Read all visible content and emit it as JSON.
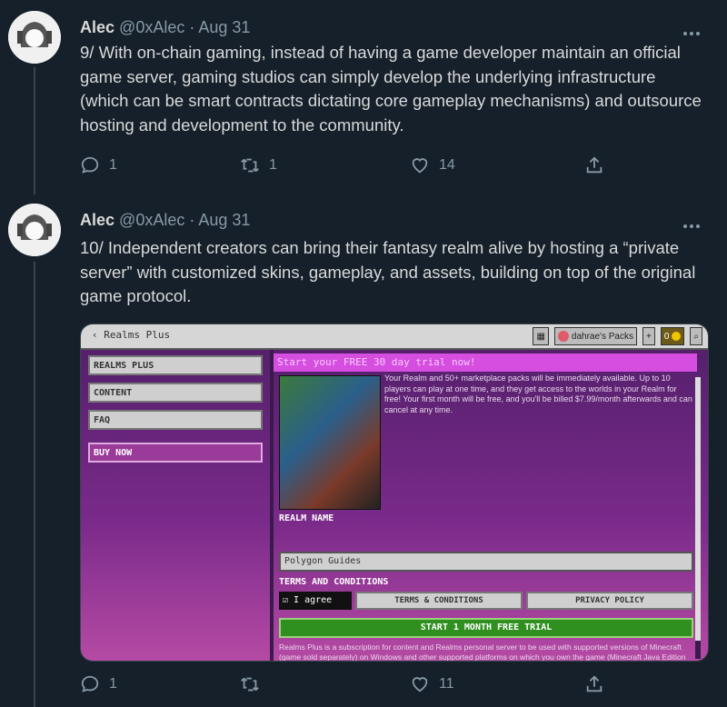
{
  "tweets": [
    {
      "author": "Alec",
      "handle": "@0xAlec",
      "dot": "·",
      "date": "Aug 31",
      "text": "9/ With on-chain gaming, instead of having a game developer maintain an official game server, gaming studios can simply develop the underlying infrastructure (which can be smart contracts dictating core gameplay mechanisms) and outsource hosting and development to the community.",
      "replies": "1",
      "retweets": "1",
      "likes": "14"
    },
    {
      "author": "Alec",
      "handle": "@0xAlec",
      "dot": "·",
      "date": "Aug 31",
      "text": "10/ Independent creators can bring their fantasy realm alive by hosting a “private server” with customized skins, gameplay, and assets, building on top of the original game protocol.",
      "replies": "1",
      "retweets": "",
      "likes": "11"
    }
  ],
  "media": {
    "title": "Realms Plus",
    "account": "dahrae's Packs",
    "coins": "0",
    "nav": [
      "REALMS PLUS",
      "CONTENT",
      "FAQ",
      "BUY NOW"
    ],
    "banner": "Start your FREE 30 day trial now!",
    "description": "Your Realm and 50+ marketplace packs will be immediately available. Up to 10 players can play at one time, and they get access to the worlds in your Realm for free! Your first month will be free, and you'll be billed $7.99/month afterwards and can cancel at any time.",
    "realm_name_label": "REALM NAME",
    "realm_name_value": "Polygon Guides",
    "terms_label": "TERMS AND CONDITIONS",
    "agree_label": "I agree",
    "terms_button": "TERMS & CONDITIONS",
    "privacy_button": "PRIVACY POLICY",
    "cta": "START 1 MONTH FREE TRIAL",
    "fine_print": "Realms Plus is a subscription for content and Realms personal server to be used with supported versions of Minecraft (game sold separately) on Windows and other supported platforms on which you own the game (Minecraft Java Edition not supported); an active subscription is required to use Realms Plus content. If your subscription terminates or a content item is removed from the catalog"
  },
  "colors": {
    "background": "#15202b",
    "text": "#d9d9d9",
    "muted": "#8899a6"
  }
}
